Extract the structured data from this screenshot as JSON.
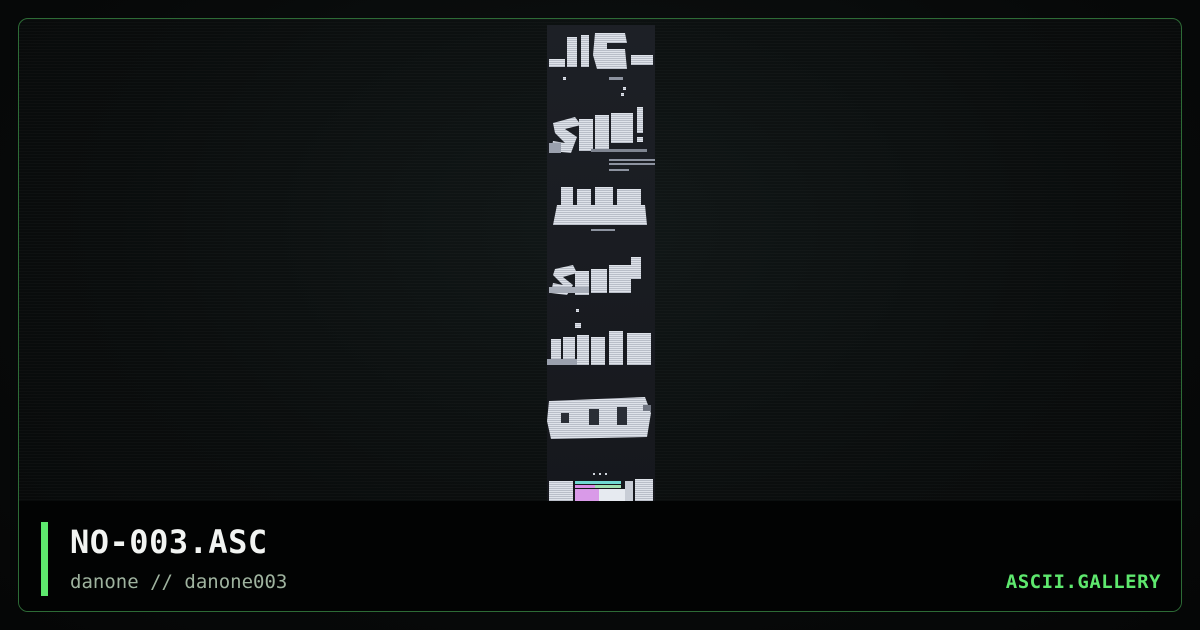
{
  "artwork": {
    "title": "NO-003.ASC",
    "subtitle": "danone // danone003",
    "brand": "ASCII.GALLERY"
  },
  "colors": {
    "accent": "#5ee86e",
    "frame_border": "#2d6b36",
    "background": "#070909",
    "footer": "#020303"
  }
}
